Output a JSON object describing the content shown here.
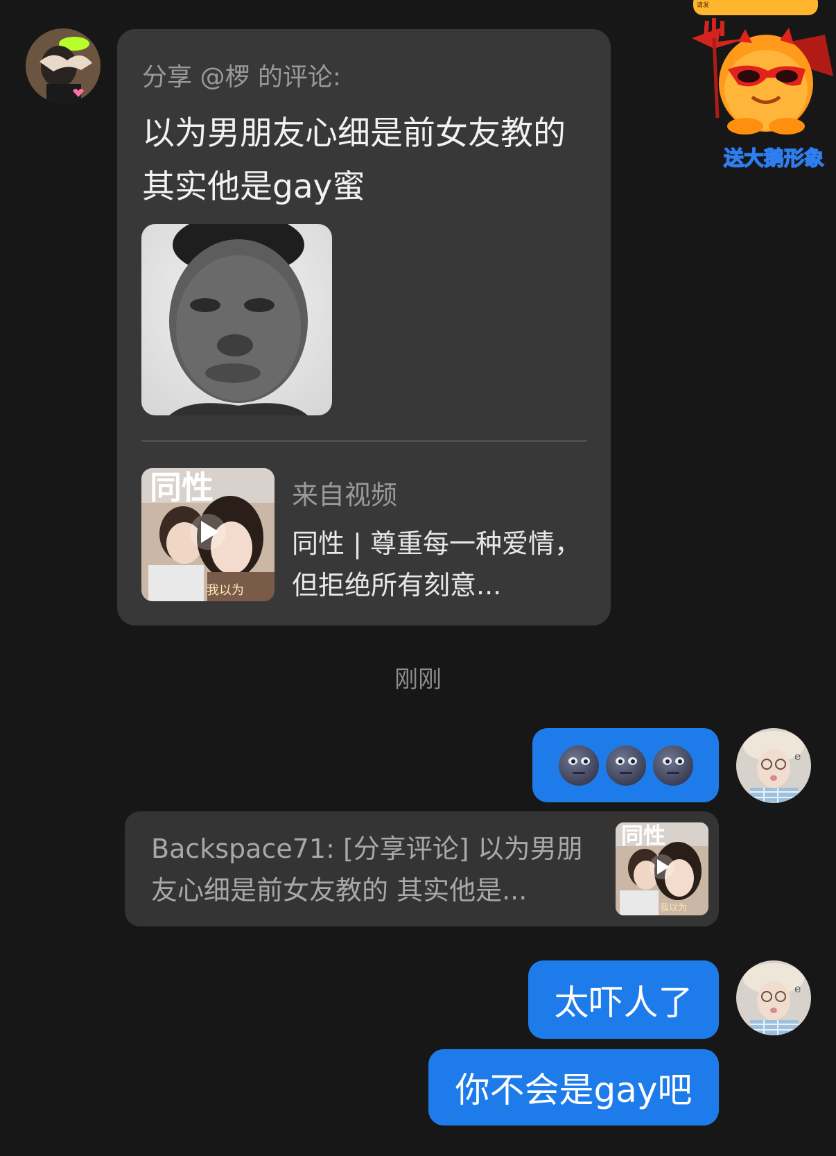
{
  "share_card": {
    "header": "分享 @椤 的评论:",
    "body": "以为男朋友心细是前女友教的 其实他是gay蜜",
    "video": {
      "source_label": "来自视频",
      "title": "同性 | 尊重每一种爱情，但拒绝所有刻意...",
      "thumb_caption": "我以为",
      "thumb_heading": "同性"
    }
  },
  "timestamp": "刚刚",
  "messages": {
    "emoji_bubble": [
      "new-moon-face",
      "new-moon-face",
      "new-moon-face"
    ],
    "quote": {
      "text": "Backspace71: [分享评论] 以为男朋友心细是前女友教的 其实他是...",
      "thumb_caption": "我以为",
      "thumb_heading": "同性"
    },
    "text_1": "太吓人了",
    "text_2": "你不会是gay吧"
  },
  "promo": {
    "label": "送大鹅形象",
    "top_text": "请发"
  },
  "colors": {
    "background": "#171717",
    "card": "#383838",
    "outgoing_bubble": "#1e7bea",
    "muted_text": "#9a9a9a"
  }
}
